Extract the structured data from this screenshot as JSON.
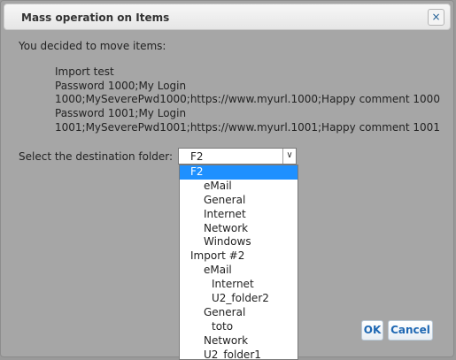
{
  "dialog": {
    "title": "Mass operation on Items",
    "close_icon": "×"
  },
  "message": {
    "intro": "You decided to move items:",
    "items": [
      "Import test",
      "Password 1000;My Login",
      "1000;MySeverePwd1000;https://www.myurl.1000;Happy comment 1000",
      "Password 1001;My Login",
      "1001;MySeverePwd1001;https://www.myurl.1001;Happy comment 1001"
    ]
  },
  "destination": {
    "label": "Select the destination folder:",
    "selected": "F2",
    "arrow_icon": "∨",
    "options": [
      {
        "label": "F2",
        "level": 0,
        "selected": true
      },
      {
        "label": "eMail",
        "level": 1,
        "selected": false
      },
      {
        "label": "General",
        "level": 1,
        "selected": false
      },
      {
        "label": "Internet",
        "level": 1,
        "selected": false
      },
      {
        "label": "Network",
        "level": 1,
        "selected": false
      },
      {
        "label": "Windows",
        "level": 1,
        "selected": false
      },
      {
        "label": "Import #2",
        "level": 0,
        "selected": false
      },
      {
        "label": "eMail",
        "level": 1,
        "selected": false
      },
      {
        "label": "Internet",
        "level": 2,
        "selected": false
      },
      {
        "label": "U2_folder2",
        "level": 2,
        "selected": false
      },
      {
        "label": "General",
        "level": 1,
        "selected": false
      },
      {
        "label": "toto",
        "level": 2,
        "selected": false
      },
      {
        "label": "Network",
        "level": 1,
        "selected": false
      },
      {
        "label": "U2_folder1",
        "level": 1,
        "selected": false
      }
    ]
  },
  "buttons": {
    "ok": "OK",
    "cancel": "Cancel"
  }
}
